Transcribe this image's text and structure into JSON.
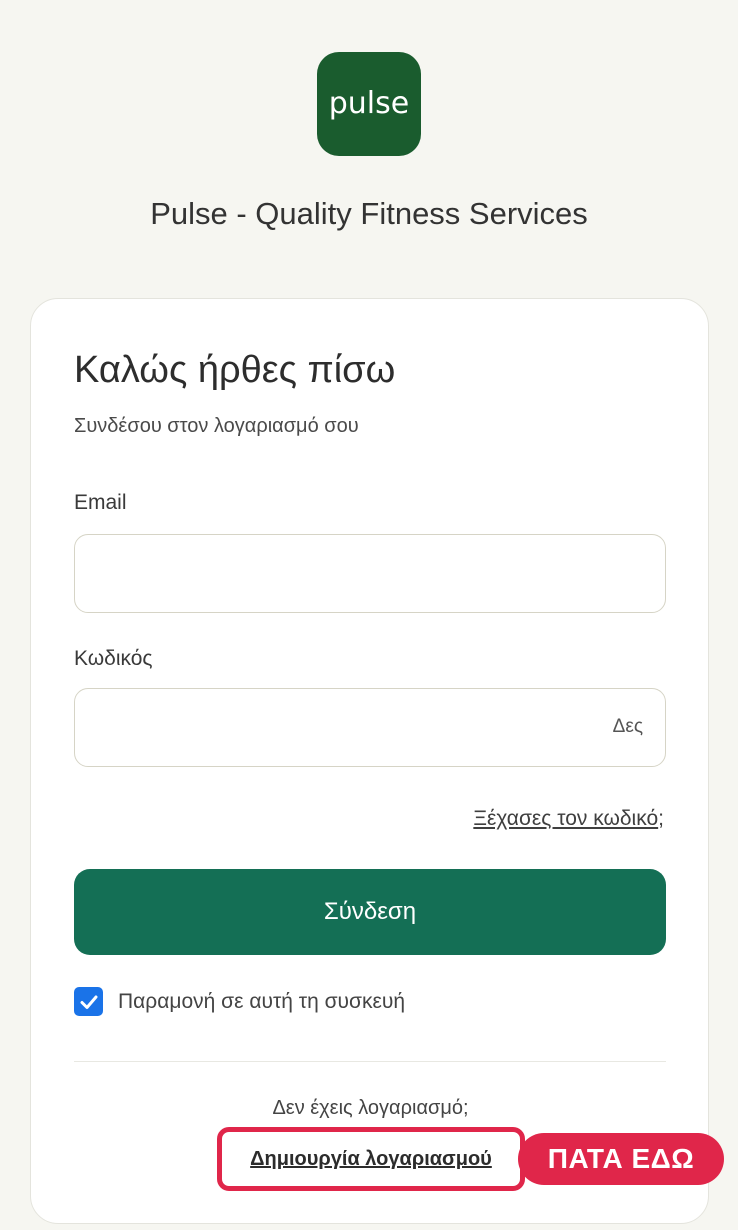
{
  "brand": {
    "logo_text": "pulse",
    "logo_color": "#1a5c2e",
    "title": "Pulse - Quality Fitness Services"
  },
  "login": {
    "title": "Καλώς ήρθες πίσω",
    "subtitle": "Συνδέσου στον λογαριασμό σου",
    "email_label": "Email",
    "email_value": "",
    "email_placeholder": "",
    "password_label": "Κωδικός",
    "password_value": "",
    "password_placeholder": "",
    "show_password": "Δες",
    "forgot_link": "Ξέχασες τον κωδικό",
    "forgot_suffix": ";",
    "submit_label": "Σύνδεση",
    "submit_color": "#146f55",
    "remember_label": "Παραμονή σε αυτή τη συσκευή",
    "remember_checked": true,
    "no_account_text": "Δεν έχεις λογαριασμό;",
    "create_account_link": "Δημιουργία λογαριασμού"
  },
  "annotation": {
    "callout_text": "ΠΑΤΑ ΕΔΩ",
    "highlight_color": "#e0264a"
  }
}
